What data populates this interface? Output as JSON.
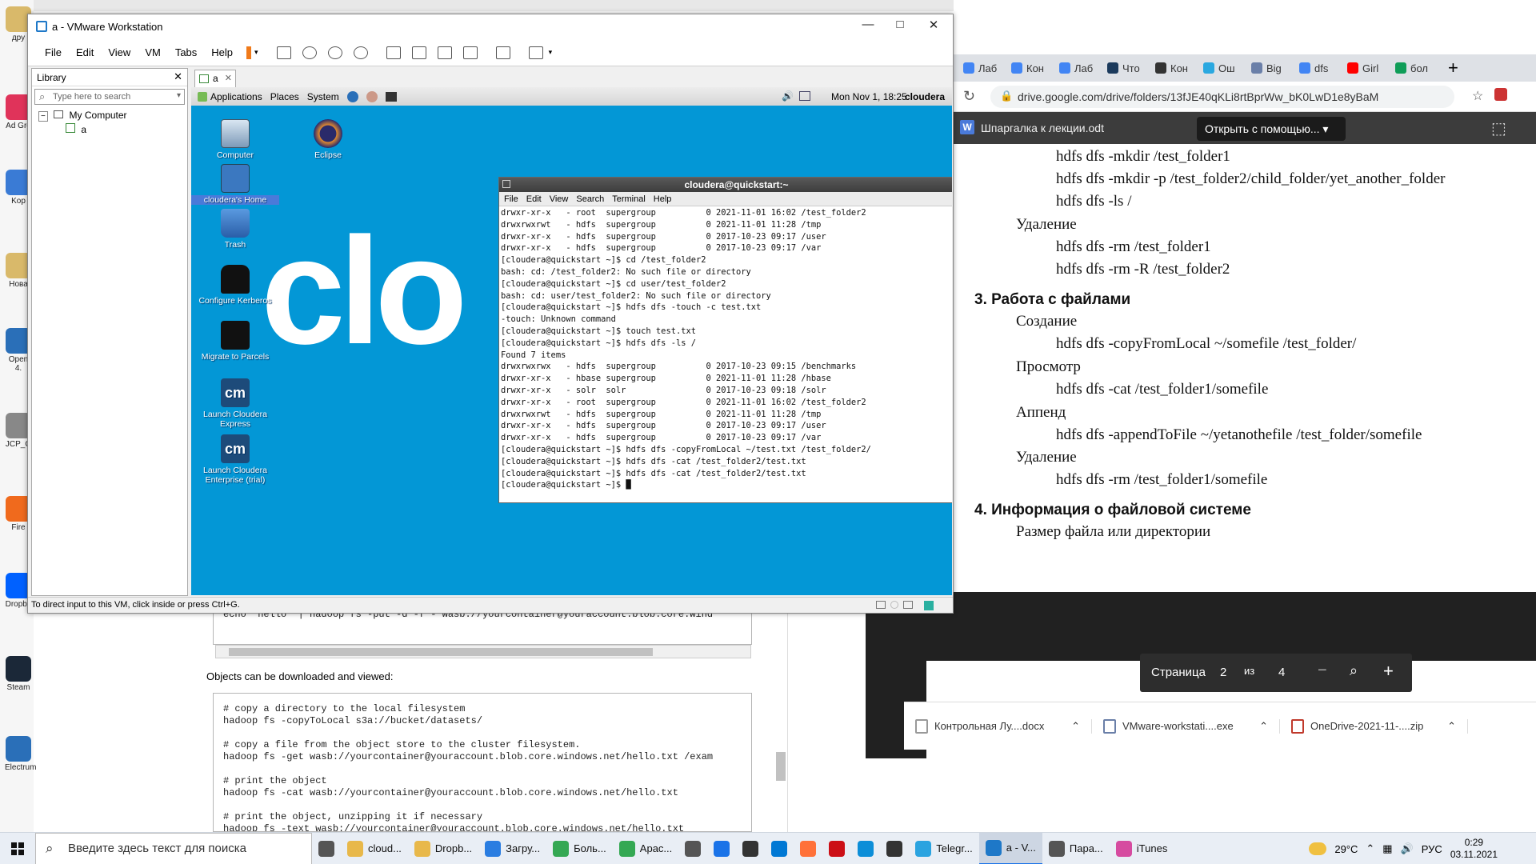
{
  "desktop_icons": [
    {
      "label": "дру",
      "color": "#d9b96a"
    },
    {
      "label": "Ad Gre",
      "color": "#e0335a"
    },
    {
      "label": "Kop",
      "color": "#3a7bd5"
    },
    {
      "label": "Нова",
      "color": "#d9b96a"
    },
    {
      "label": "Open 4.",
      "color": "#2a6fb8"
    },
    {
      "label": "JCP_G",
      "color": "#888888"
    },
    {
      "label": "Fire",
      "color": "#f06a1d"
    },
    {
      "label": "Dropbo",
      "color": "#0061ff"
    },
    {
      "label": "Steam",
      "color": "#1b2838"
    },
    {
      "label": "Electrum",
      "color": "#2a6fb8"
    }
  ],
  "docs": {
    "code_top": "echo \"hello\" | hadoop fs -put -d -f - wasb://yourcontainer@youraccount.blob.core.wind",
    "caption": "Objects can be downloaded and viewed:",
    "code_main": "# copy a directory to the local filesystem\nhadoop fs -copyToLocal s3a://bucket/datasets/\n\n# copy a file from the object store to the cluster filesystem.\nhadoop fs -get wasb://yourcontainer@youraccount.blob.core.windows.net/hello.txt /exam\n\n# print the object\nhadoop fs -cat wasb://yourcontainer@youraccount.blob.core.windows.net/hello.txt\n\n# print the object, unzipping it if necessary\nhadoop fs -text wasb://yourcontainer@youraccount.blob.core.windows.net/hello.txt"
  },
  "chrome": {
    "tabs": [
      {
        "label": "Лаб",
        "color": "#4285f4"
      },
      {
        "label": "Кон",
        "color": "#4285f4"
      },
      {
        "label": "Лаб",
        "color": "#4285f4"
      },
      {
        "label": "Что",
        "color": "#1b3a5c"
      },
      {
        "label": "Кон",
        "color": "#333333"
      },
      {
        "label": "Ош",
        "color": "#2aa8e0"
      },
      {
        "label": "Big",
        "color": "#6a7fa8"
      },
      {
        "label": "dfs",
        "color": "#4285f4"
      },
      {
        "label": "Girl",
        "color": "#ff0000"
      },
      {
        "label": "бол",
        "color": "#0f9d58"
      }
    ],
    "url": "drive.google.com/drive/folders/13fJE40qKLi8rtBprWw_bK0LwD1e8yBaM",
    "doc_title": "Шпаргалка к лекции.odt",
    "open_with": "Открыть с помощью...",
    "doc_lines": [
      "hdfs dfs -mkdir /test_folder1",
      "hdfs dfs -mkdir -p /test_folder2/child_folder/yet_another_folder",
      "hdfs dfs -ls /",
      "Удаление",
      "hdfs dfs -rm /test_folder1",
      "hdfs dfs -rm -R /test_folder2",
      "3. Работа с файлами",
      "Создание",
      "hdfs dfs -copyFromLocal ~/somefile  /test_folder/",
      "Просмотр",
      "hdfs dfs -cat   /test_folder1/somefile",
      "Аппенд",
      "hdfs dfs -appendToFile  ~/yetanothefile /test_folder/somefile",
      "Удаление",
      "hdfs dfs -rm   /test_folder1/somefile",
      "4. Информация о файловой системе",
      "Размер файла или директории"
    ],
    "page_label": "Страница",
    "page_current": "2",
    "page_of": "из",
    "page_total": "4",
    "downloads": [
      {
        "label": "Контрольная Лу....docx",
        "color": "#999999"
      },
      {
        "label": "VMware-workstati....exe",
        "color": "#6a7fa8"
      },
      {
        "label": "OneDrive-2021-11-....zip",
        "color": "#c0392b"
      }
    ]
  },
  "vmware": {
    "title": "a - VMware Workstation",
    "menu": [
      "File",
      "Edit",
      "View",
      "VM",
      "Tabs",
      "Help"
    ],
    "library_title": "Library",
    "search_placeholder": "Type here to search",
    "tree_root": "My Computer",
    "tree_child": "a",
    "tab_label": "a",
    "status": "To direct input to this VM, click inside or press Ctrl+G."
  },
  "guest": {
    "panel": [
      "Applications",
      "Places",
      "System"
    ],
    "datetime": "Mon Nov  1, 18:25",
    "user": "cloudera",
    "logo_text": "clo",
    "icons": [
      {
        "label": "Computer"
      },
      {
        "label": "Eclipse"
      },
      {
        "label": "cloudera's Home"
      },
      {
        "label": "Trash"
      },
      {
        "label": "Configure Kerberos"
      },
      {
        "label": "Migrate to Parcels"
      },
      {
        "label": "Launch Cloudera Express",
        "glyph": "cm"
      },
      {
        "label": "Launch Cloudera Enterprise (trial)",
        "glyph": "cm"
      }
    ]
  },
  "terminal": {
    "title": "cloudera@quickstart:~",
    "menu": [
      "File",
      "Edit",
      "View",
      "Search",
      "Terminal",
      "Help"
    ],
    "lines": [
      "drwxr-xr-x   - root  supergroup          0 2021-11-01 16:02 /test_folder2",
      "drwxrwxrwt   - hdfs  supergroup          0 2021-11-01 11:28 /tmp",
      "drwxr-xr-x   - hdfs  supergroup          0 2017-10-23 09:17 /user",
      "drwxr-xr-x   - hdfs  supergroup          0 2017-10-23 09:17 /var",
      "[cloudera@quickstart ~]$ cd /test_folder2",
      "bash: cd: /test_folder2: No such file or directory",
      "[cloudera@quickstart ~]$ cd user/test_folder2",
      "bash: cd: user/test_folder2: No such file or directory",
      "[cloudera@quickstart ~]$ hdfs dfs -touch -c test.txt",
      "-touch: Unknown command",
      "[cloudera@quickstart ~]$ touch test.txt",
      "[cloudera@quickstart ~]$ hdfs dfs -ls /",
      "Found 7 items",
      "drwxrwxrwx   - hdfs  supergroup          0 2017-10-23 09:15 /benchmarks",
      "drwxr-xr-x   - hbase supergroup          0 2021-11-01 11:28 /hbase",
      "drwxr-xr-x   - solr  solr                0 2017-10-23 09:18 /solr",
      "drwxr-xr-x   - root  supergroup          0 2021-11-01 16:02 /test_folder2",
      "drwxrwxrwt   - hdfs  supergroup          0 2021-11-01 11:28 /tmp",
      "drwxr-xr-x   - hdfs  supergroup          0 2017-10-23 09:17 /user",
      "drwxr-xr-x   - hdfs  supergroup          0 2017-10-23 09:17 /var",
      "[cloudera@quickstart ~]$ hdfs dfs -copyFromLocal ~/test.txt /test_folder2/",
      "[cloudera@quickstart ~]$ hdfs dfs -cat /test_folder2/test.txt",
      "[cloudera@quickstart ~]$ hdfs dfs -cat /test_folder2/test.txt",
      "[cloudera@quickstart ~]$ █"
    ]
  },
  "taskbar": {
    "search_placeholder": "Введите здесь текст для поиска",
    "apps": [
      {
        "label": "",
        "color": "#555555"
      },
      {
        "label": "cloud...",
        "color": "#e8b84a"
      },
      {
        "label": "Dropb...",
        "color": "#e8b84a"
      },
      {
        "label": "Загру...",
        "color": "#2a7de1"
      },
      {
        "label": "Боль...",
        "color": "#34a853"
      },
      {
        "label": "Арас...",
        "color": "#34a853"
      },
      {
        "label": "",
        "color": "#555555"
      },
      {
        "label": "",
        "color": "#1a73e8"
      },
      {
        "label": "",
        "color": "#333333"
      },
      {
        "label": "",
        "color": "#0078d4"
      },
      {
        "label": "",
        "color": "#ff7139"
      },
      {
        "label": "",
        "color": "#cc0f16"
      },
      {
        "label": "",
        "color": "#0c8ed8"
      },
      {
        "label": "",
        "color": "#333333"
      },
      {
        "label": "Telegr...",
        "color": "#2aa3e0"
      },
      {
        "label": "a - V...",
        "color": "#1e78c8"
      },
      {
        "label": "Пара...",
        "color": "#555555"
      },
      {
        "label": "iTunes",
        "color": "#d64ba0"
      }
    ],
    "weather": "29°C",
    "lang": "РУС",
    "time": "0:29",
    "date": "03.11.2021"
  }
}
